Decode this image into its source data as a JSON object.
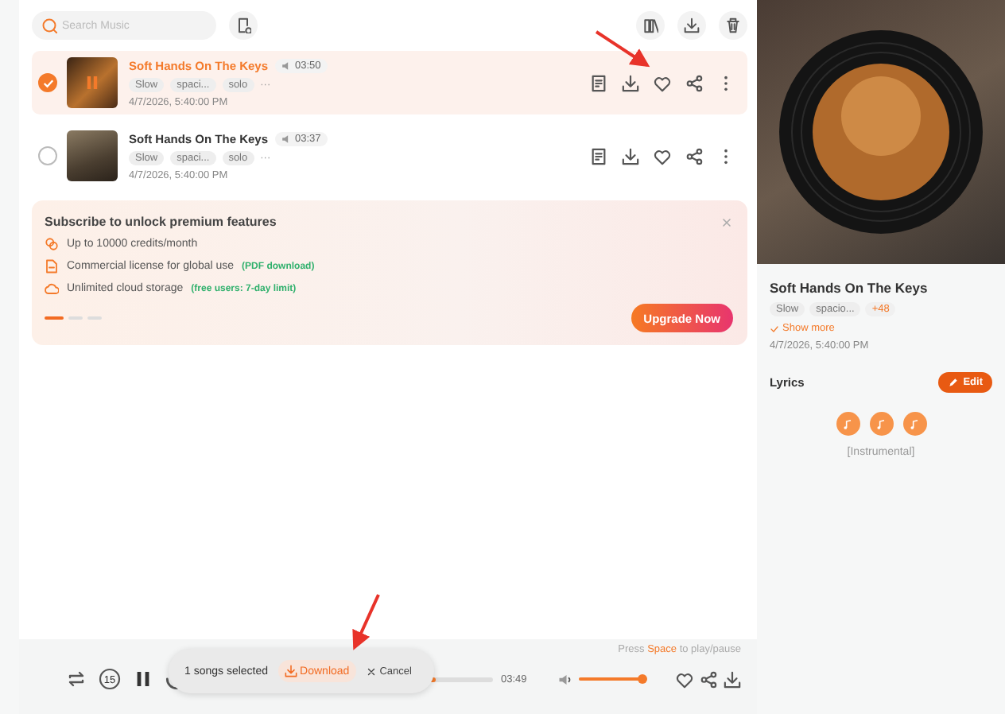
{
  "search": {
    "placeholder": "Search Music"
  },
  "songs": [
    {
      "title": "Soft Hands On The Keys",
      "duration": "03:50",
      "tags": [
        "Slow",
        "spaci...",
        "solo"
      ],
      "more": "···",
      "date": "4/7/2026, 5:40:00 PM",
      "selected": true,
      "playing": true
    },
    {
      "title": "Soft Hands On The Keys",
      "duration": "03:37",
      "tags": [
        "Slow",
        "spaci...",
        "solo"
      ],
      "more": "···",
      "date": "4/7/2026, 5:40:00 PM",
      "selected": false,
      "playing": false
    }
  ],
  "promo": {
    "title": "Subscribe to unlock premium features",
    "features": [
      {
        "kind": "credits",
        "text": "Up to 10000 credits/month"
      },
      {
        "kind": "license",
        "text": "Commercial license for global use",
        "note": "(PDF download)"
      },
      {
        "kind": "storage",
        "text": "Unlimited cloud storage",
        "note": "(free users: 7-day limit)"
      }
    ],
    "pages": [
      {
        "selected": true
      },
      {
        "selected": false
      },
      {
        "selected": false
      }
    ],
    "button": "Upgrade Now"
  },
  "detail": {
    "title": "Soft Hands On The Keys",
    "tags": [
      "Slow",
      "spacio..."
    ],
    "extra_tags": "+48",
    "show_more": "Show more",
    "date": "4/7/2026, 5:40:00 PM",
    "lyrics_label": "Lyrics",
    "edit": "Edit",
    "lyrics": "[Instrumental]"
  },
  "player": {
    "hint": {
      "before": "Press ",
      "key": "Space",
      "after": " to play/pause"
    },
    "rewind_label": "15",
    "progress": {
      "level": 0.8
    },
    "time": "03:49",
    "volume": {
      "level": 1.0
    }
  },
  "selection": {
    "count_text": "1 songs selected",
    "download": "Download",
    "cancel": "Cancel"
  }
}
